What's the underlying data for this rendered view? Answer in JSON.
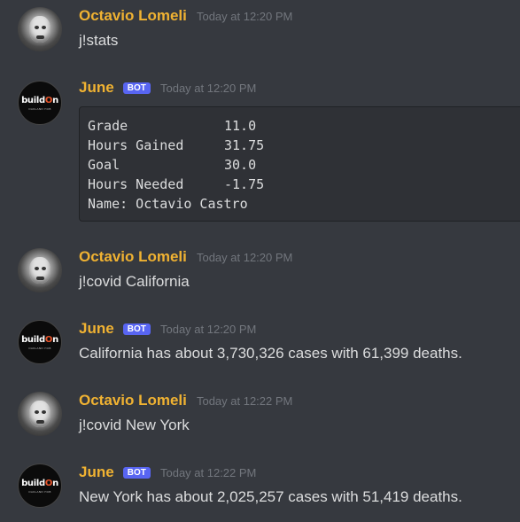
{
  "messages": [
    {
      "author": "Octavio Lomeli",
      "is_bot": false,
      "timestamp": "Today at 12:20 PM",
      "text": "j!stats"
    },
    {
      "author": "June",
      "is_bot": true,
      "bot_tag": "BOT",
      "timestamp": "Today at 12:20 PM",
      "code_rows": [
        {
          "key": "Grade",
          "value": "11.0"
        },
        {
          "key": "Hours Gained",
          "value": "31.75"
        },
        {
          "key": "Goal",
          "value": "30.0"
        },
        {
          "key": "Hours Needed",
          "value": "-1.75"
        }
      ],
      "code_last_line": "Name: Octavio Castro"
    },
    {
      "author": "Octavio Lomeli",
      "is_bot": false,
      "timestamp": "Today at 12:20 PM",
      "text": "j!covid California"
    },
    {
      "author": "June",
      "is_bot": true,
      "bot_tag": "BOT",
      "timestamp": "Today at 12:20 PM",
      "text": "California has about 3,730,326 cases with 61,399 deaths."
    },
    {
      "author": "Octavio Lomeli",
      "is_bot": false,
      "timestamp": "Today at 12:22 PM",
      "text": "j!covid New York"
    },
    {
      "author": "June",
      "is_bot": true,
      "bot_tag": "BOT",
      "timestamp": "Today at 12:22 PM",
      "text": "New York has about 2,025,257 cases with 51,419 deaths."
    }
  ],
  "bot_avatar_logo": "buildOn",
  "bot_avatar_sub": "OAKLAND HUB",
  "colors": {
    "background": "#36393f",
    "username": "#f0b232",
    "bot_tag": "#5865f2",
    "timestamp": "#72767d",
    "text": "#dcddde"
  },
  "icons": {
    "user_avatar": "user-avatar-icon",
    "bot_avatar": "buildon-logo-icon"
  }
}
